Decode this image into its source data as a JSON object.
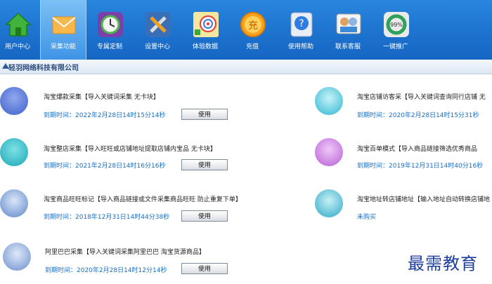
{
  "toolbar": {
    "items": [
      {
        "label": "用户中心",
        "icon": "home-icon"
      },
      {
        "label": "采集功能",
        "icon": "envelope-icon"
      },
      {
        "label": "专属定制",
        "icon": "clock-icon"
      },
      {
        "label": "设置中心",
        "icon": "tools-icon"
      },
      {
        "label": "体验数据",
        "icon": "target-icon"
      },
      {
        "label": "充值",
        "icon": "coin-icon"
      },
      {
        "label": "使用帮助",
        "icon": "help-icon"
      },
      {
        "label": "联系客服",
        "icon": "support-icon"
      },
      {
        "label": "一键推广",
        "icon": "progress-icon"
      }
    ]
  },
  "subbar": {
    "company": "轻羽网络科技有限公司"
  },
  "items": [
    {
      "title": "淘宝爆款采集【导入关键词采集 无卡块】",
      "expiry": "到期时间：2022年2月28日14时15分14秒",
      "button": "使用"
    },
    {
      "title": "淘宝店铺访客采【导入关键词查询同行店铺 无",
      "expiry": "到期时间：2020年2月28日14时15分31秒",
      "button": "使用"
    },
    {
      "title": "淘宝整店采集【导入旺旺或店铺地址提取店铺内宝品 无卡块】",
      "expiry": "到期时间：2021年2月28日14时16分16秒",
      "button": "使用"
    },
    {
      "title": "淘宝百单模式【导入商品链接筛选优秀商品",
      "expiry": "到期时间：2019年12月31日14时40分16秒",
      "button": "使用"
    },
    {
      "title": "淘宝商品旺旺标记【导入商品链接或文件采集商品旺旺 防止重复下单】",
      "expiry": "到期时间：2018年12月31日14时44分38秒",
      "button": "使用"
    },
    {
      "title": "淘宝地址转店铺地址【输入地址自动转换店铺地",
      "expiry": "未购买",
      "button": ""
    },
    {
      "title": "阿里巴巴采集【导入关键词采集阿里巴巴 淘宝货源商品】",
      "expiry": "到期时间：2020年2月28日14时12分14秒",
      "button": "使用"
    }
  ],
  "watermark": "最需教育"
}
